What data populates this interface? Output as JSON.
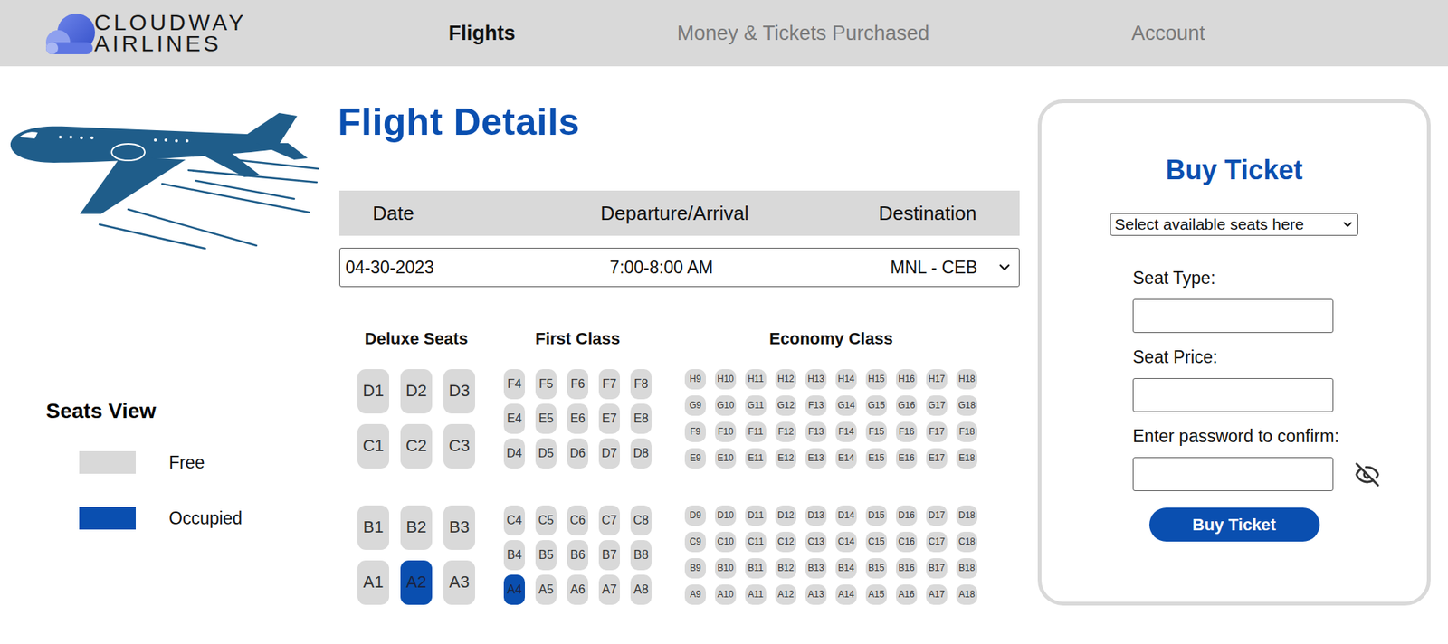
{
  "nav": {
    "brand": [
      "CLOUDWAY",
      "AIRLINES"
    ],
    "items": [
      {
        "label": "Flights",
        "selected": true
      },
      {
        "label": "Money & Tickets Purchased",
        "selected": false
      },
      {
        "label": "Account",
        "selected": false
      }
    ]
  },
  "title": "Flight Details",
  "flight_table": {
    "columns": [
      "Date",
      "Departure/Arrival",
      "Destination"
    ],
    "row": {
      "date": "04-30-2023",
      "time": "7:00-8:00 AM",
      "destination": "MNL - CEB"
    }
  },
  "legend": {
    "title": "Seats View",
    "items": [
      {
        "label": "Free",
        "occupied": false
      },
      {
        "label": "Occupied",
        "occupied": true
      }
    ]
  },
  "seat_classes": [
    {
      "name": "Deluxe Seats",
      "kind": "deluxe",
      "groups": [
        [
          [
            {
              "label": "D1",
              "occupied": false
            },
            {
              "label": "D2",
              "occupied": false
            },
            {
              "label": "D3",
              "occupied": false
            }
          ],
          [
            {
              "label": "C1",
              "occupied": false
            },
            {
              "label": "C2",
              "occupied": false
            },
            {
              "label": "C3",
              "occupied": false
            }
          ]
        ],
        [
          [
            {
              "label": "B1",
              "occupied": false
            },
            {
              "label": "B2",
              "occupied": false
            },
            {
              "label": "B3",
              "occupied": false
            }
          ],
          [
            {
              "label": "A1",
              "occupied": false
            },
            {
              "label": "A2",
              "occupied": true
            },
            {
              "label": "A3",
              "occupied": false
            }
          ]
        ]
      ]
    },
    {
      "name": "First Class",
      "kind": "first",
      "groups": [
        [
          [
            {
              "label": "F4",
              "occupied": false
            },
            {
              "label": "F5",
              "occupied": false
            },
            {
              "label": "F6",
              "occupied": false
            },
            {
              "label": "F7",
              "occupied": false
            },
            {
              "label": "F8",
              "occupied": false
            }
          ],
          [
            {
              "label": "E4",
              "occupied": false
            },
            {
              "label": "E5",
              "occupied": false
            },
            {
              "label": "E6",
              "occupied": false
            },
            {
              "label": "E7",
              "occupied": false
            },
            {
              "label": "E8",
              "occupied": false
            }
          ],
          [
            {
              "label": "D4",
              "occupied": false
            },
            {
              "label": "D5",
              "occupied": false
            },
            {
              "label": "D6",
              "occupied": false
            },
            {
              "label": "D7",
              "occupied": false
            },
            {
              "label": "D8",
              "occupied": false
            }
          ]
        ],
        [
          [
            {
              "label": "C4",
              "occupied": false
            },
            {
              "label": "C5",
              "occupied": false
            },
            {
              "label": "C6",
              "occupied": false
            },
            {
              "label": "C7",
              "occupied": false
            },
            {
              "label": "C8",
              "occupied": false
            }
          ],
          [
            {
              "label": "B4",
              "occupied": false
            },
            {
              "label": "B5",
              "occupied": false
            },
            {
              "label": "B6",
              "occupied": false
            },
            {
              "label": "B7",
              "occupied": false
            },
            {
              "label": "B8",
              "occupied": false
            }
          ],
          [
            {
              "label": "A4",
              "occupied": true
            },
            {
              "label": "A5",
              "occupied": false
            },
            {
              "label": "A6",
              "occupied": false
            },
            {
              "label": "A7",
              "occupied": false
            },
            {
              "label": "A8",
              "occupied": false
            }
          ]
        ]
      ]
    },
    {
      "name": "Economy Class",
      "kind": "economy",
      "groups": [
        [
          [
            {
              "label": "H9",
              "occupied": false
            },
            {
              "label": "H10",
              "occupied": false
            },
            {
              "label": "H11",
              "occupied": false
            },
            {
              "label": "H12",
              "occupied": false
            },
            {
              "label": "H13",
              "occupied": false
            },
            {
              "label": "H14",
              "occupied": false
            },
            {
              "label": "H15",
              "occupied": false
            },
            {
              "label": "H16",
              "occupied": false
            },
            {
              "label": "H17",
              "occupied": false
            },
            {
              "label": "H18",
              "occupied": false
            }
          ],
          [
            {
              "label": "G9",
              "occupied": false
            },
            {
              "label": "G10",
              "occupied": false
            },
            {
              "label": "G11",
              "occupied": false
            },
            {
              "label": "G12",
              "occupied": false
            },
            {
              "label": "F13",
              "occupied": false
            },
            {
              "label": "G14",
              "occupied": false
            },
            {
              "label": "G15",
              "occupied": false
            },
            {
              "label": "G16",
              "occupied": false
            },
            {
              "label": "G17",
              "occupied": false
            },
            {
              "label": "G18",
              "occupied": false
            }
          ],
          [
            {
              "label": "F9",
              "occupied": false
            },
            {
              "label": "F10",
              "occupied": false
            },
            {
              "label": "F11",
              "occupied": false
            },
            {
              "label": "F12",
              "occupied": false
            },
            {
              "label": "F13",
              "occupied": false
            },
            {
              "label": "F14",
              "occupied": false
            },
            {
              "label": "F15",
              "occupied": false
            },
            {
              "label": "F16",
              "occupied": false
            },
            {
              "label": "F17",
              "occupied": false
            },
            {
              "label": "F18",
              "occupied": false
            }
          ],
          [
            {
              "label": "E9",
              "occupied": false
            },
            {
              "label": "E10",
              "occupied": false
            },
            {
              "label": "E11",
              "occupied": false
            },
            {
              "label": "E12",
              "occupied": false
            },
            {
              "label": "E13",
              "occupied": false
            },
            {
              "label": "E14",
              "occupied": false
            },
            {
              "label": "E15",
              "occupied": false
            },
            {
              "label": "E16",
              "occupied": false
            },
            {
              "label": "E17",
              "occupied": false
            },
            {
              "label": "E18",
              "occupied": false
            }
          ]
        ],
        [
          [
            {
              "label": "D9",
              "occupied": false
            },
            {
              "label": "D10",
              "occupied": false
            },
            {
              "label": "D11",
              "occupied": false
            },
            {
              "label": "D12",
              "occupied": false
            },
            {
              "label": "D13",
              "occupied": false
            },
            {
              "label": "D14",
              "occupied": false
            },
            {
              "label": "D15",
              "occupied": false
            },
            {
              "label": "D16",
              "occupied": false
            },
            {
              "label": "D17",
              "occupied": false
            },
            {
              "label": "D18",
              "occupied": false
            }
          ],
          [
            {
              "label": "C9",
              "occupied": false
            },
            {
              "label": "C10",
              "occupied": false
            },
            {
              "label": "C11",
              "occupied": false
            },
            {
              "label": "C12",
              "occupied": false
            },
            {
              "label": "C13",
              "occupied": false
            },
            {
              "label": "C14",
              "occupied": false
            },
            {
              "label": "C15",
              "occupied": false
            },
            {
              "label": "C16",
              "occupied": false
            },
            {
              "label": "C17",
              "occupied": false
            },
            {
              "label": "C18",
              "occupied": false
            }
          ],
          [
            {
              "label": "B9",
              "occupied": false
            },
            {
              "label": "B10",
              "occupied": false
            },
            {
              "label": "B11",
              "occupied": false
            },
            {
              "label": "B12",
              "occupied": false
            },
            {
              "label": "B13",
              "occupied": false
            },
            {
              "label": "B14",
              "occupied": false
            },
            {
              "label": "B15",
              "occupied": false
            },
            {
              "label": "B16",
              "occupied": false
            },
            {
              "label": "B17",
              "occupied": false
            },
            {
              "label": "B18",
              "occupied": false
            }
          ],
          [
            {
              "label": "A9",
              "occupied": false
            },
            {
              "label": "A10",
              "occupied": false
            },
            {
              "label": "A11",
              "occupied": false
            },
            {
              "label": "A12",
              "occupied": false
            },
            {
              "label": "A13",
              "occupied": false
            },
            {
              "label": "A14",
              "occupied": false
            },
            {
              "label": "A15",
              "occupied": false
            },
            {
              "label": "A16",
              "occupied": false
            },
            {
              "label": "A17",
              "occupied": false
            },
            {
              "label": "A18",
              "occupied": false
            }
          ]
        ]
      ]
    }
  ],
  "buy_panel": {
    "title": "Buy Ticket",
    "seat_select": "Select available seats here",
    "fields": [
      {
        "label": "Seat Type:",
        "value": "",
        "kind": "text"
      },
      {
        "label": "Seat Price:",
        "value": "",
        "kind": "text"
      },
      {
        "label": "Enter password to confirm:",
        "value": "",
        "kind": "password"
      }
    ],
    "button": "Buy Ticket"
  }
}
